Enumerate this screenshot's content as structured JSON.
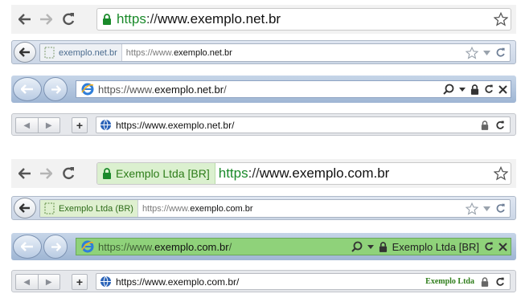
{
  "normal": {
    "chrome": {
      "scheme": "https",
      "sep": "://",
      "host": "www.exemplo.net.br"
    },
    "firefox": {
      "identity": "exemplo.net.br",
      "url_prefix": "https://www.",
      "url_host": "exemplo.net.br"
    },
    "ie": {
      "url_prefix": "https://www.",
      "url_host": "exemplo.net.br",
      "url_suffix": "/"
    },
    "opera": {
      "url": "https://www.exemplo.net.br/"
    }
  },
  "ev": {
    "chrome": {
      "org": "Exemplo Ltda [BR]",
      "scheme": "https",
      "sep": "://",
      "host": "www.exemplo.com.br"
    },
    "firefox": {
      "identity": "Exemplo Ltda (BR)",
      "url_prefix": "https://www.",
      "url_host": "exemplo.com.br"
    },
    "ie": {
      "url_prefix": "https://www.",
      "url_host": "exemplo.com.br",
      "url_suffix": "/",
      "org": "Exemplo Ltda [BR]"
    },
    "opera": {
      "url": "https://www.exemplo.com.br/",
      "org": "Exemplo Ltda"
    }
  },
  "colors": {
    "https_green": "#1a8a2a",
    "ev_green": "#8fd27a",
    "ev_text": "#2e7d1a"
  }
}
